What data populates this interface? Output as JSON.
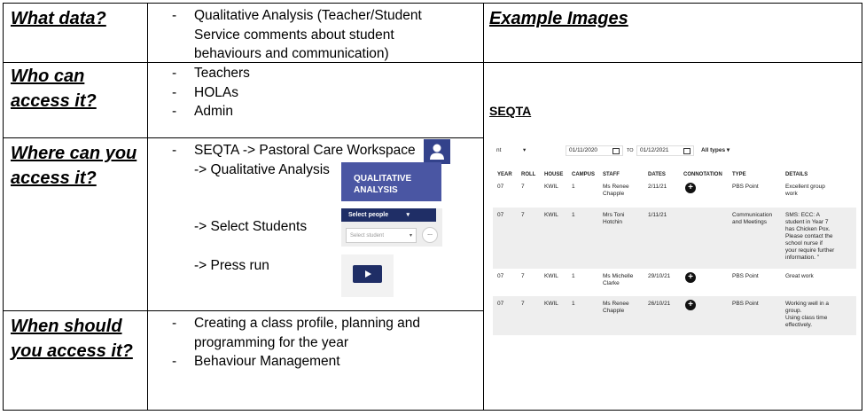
{
  "rows": {
    "what": {
      "question": "What data?",
      "bullets": [
        "Qualitative Analysis (Teacher/Student",
        "Service comments about student",
        "behaviours and communication)"
      ]
    },
    "who": {
      "question_line1": "Who can",
      "question_line2": "access it?",
      "bullets": [
        "Teachers",
        "HOLAs",
        "Admin"
      ]
    },
    "where": {
      "question_line1": "Where can you",
      "question_line2": "access it?",
      "step1": "SEQTA -> Pastoral Care Workspace",
      "step2": "-> Qualitative Analysis",
      "step3": "->  Select Students",
      "step4": "-> Press run",
      "qa_button_line1": "QUALITATIVE",
      "qa_button_line2": "ANALYSIS",
      "select_people": "Select people",
      "select_student_placeholder": "Select student",
      "dots": "..."
    },
    "when": {
      "question_line1": "When should",
      "question_line2": "you access it?",
      "bullets": [
        "Creating a class profile, planning and",
        "programming for the year",
        "Behaviour Management"
      ]
    }
  },
  "examples": {
    "heading": "Example Images",
    "seqta_label": "SEQTA",
    "filter": {
      "nt": "nt",
      "from_date": "01/11/2020",
      "to_label": "TO",
      "to_date": "01/12/2021",
      "types": "All types"
    },
    "columns": [
      "YEAR",
      "ROLL",
      "HOUSE",
      "CAMPUS",
      "STAFF",
      "DATES",
      "CONNOTATION",
      "TYPE",
      "DETAILS"
    ],
    "records": [
      {
        "year": "07",
        "roll": "7",
        "house": "KWIL",
        "campus": "1",
        "staff": [
          "Ms Renee",
          "Chapple"
        ],
        "date": "2/11/21",
        "connotation": "+",
        "type": [
          "PBS Point"
        ],
        "details": [
          "Excellent group",
          "work"
        ]
      },
      {
        "year": "07",
        "roll": "7",
        "house": "KWIL",
        "campus": "1",
        "staff": [
          "Mrs Toni",
          "Hotchin"
        ],
        "date": "1/11/21",
        "connotation": "",
        "type": [
          "Communication",
          "and Meetings"
        ],
        "details": [
          "SMS: ECC: A",
          "student in Year 7",
          "has Chicken Pox.",
          "Please contact the",
          "school nurse if",
          "your require further",
          "information. \""
        ]
      },
      {
        "year": "07",
        "roll": "7",
        "house": "KWIL",
        "campus": "1",
        "staff": [
          "Ms Michelle",
          "Clarke"
        ],
        "date": "29/10/21",
        "connotation": "+",
        "type": [
          "PBS Point"
        ],
        "details": [
          "Great work"
        ]
      },
      {
        "year": "07",
        "roll": "7",
        "house": "KWIL",
        "campus": "1",
        "staff": [
          "Ms Renee",
          "Chapple"
        ],
        "date": "26/10/21",
        "connotation": "+",
        "type": [
          "PBS Point"
        ],
        "details": [
          "Working well in a",
          "group.",
          "Using class time",
          "effectively."
        ]
      }
    ]
  }
}
